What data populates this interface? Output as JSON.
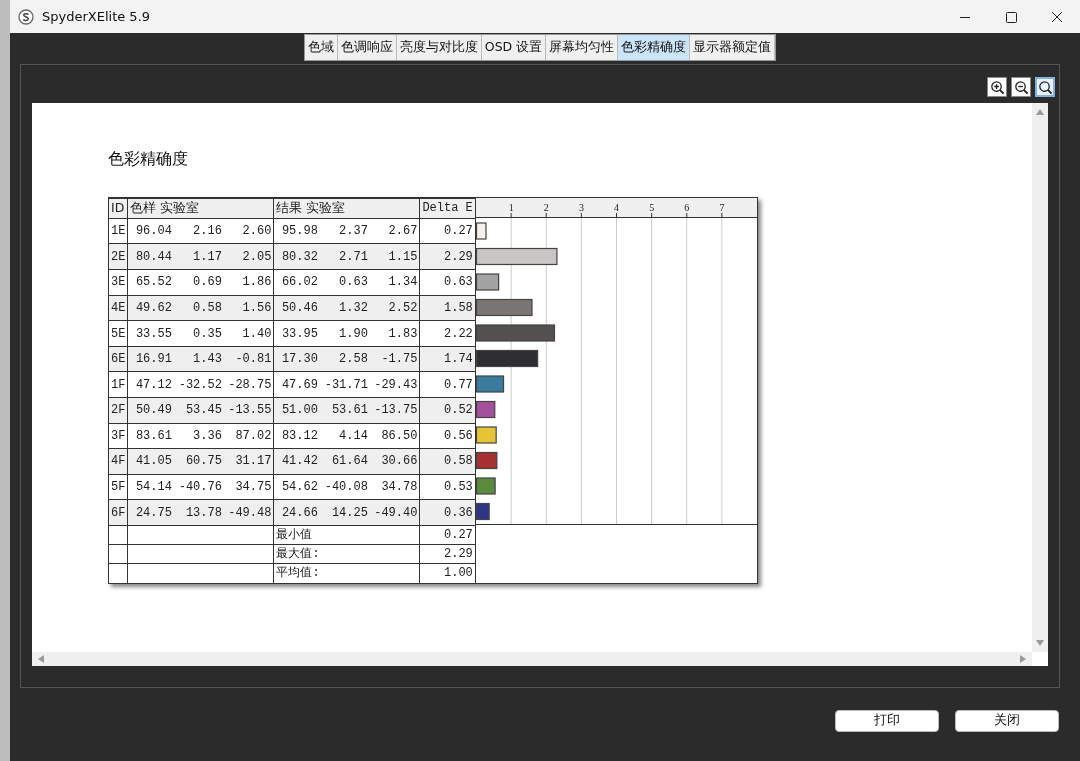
{
  "window": {
    "title": "SpyderXElite 5.9"
  },
  "tabs": [
    {
      "label": "色域",
      "selected": false
    },
    {
      "label": "色调响应",
      "selected": false
    },
    {
      "label": "亮度与对比度",
      "selected": false
    },
    {
      "label": "OSD 设置",
      "selected": false
    },
    {
      "label": "屏幕均匀性",
      "selected": false
    },
    {
      "label": "色彩精确度",
      "selected": true
    },
    {
      "label": "显示器额定值",
      "selected": false
    }
  ],
  "zoom_tools": [
    {
      "kind": "zoom-in",
      "selected": false
    },
    {
      "kind": "zoom-out",
      "selected": false
    },
    {
      "kind": "zoom-fit",
      "selected": true
    }
  ],
  "report": {
    "title": "色彩精确度",
    "table": {
      "columns": [
        "ID",
        "色样 实验室",
        "结果 实验室",
        "Delta E"
      ],
      "rows": [
        {
          "id": "1E",
          "sample": [
            "96.04",
            "2.16",
            "2.60"
          ],
          "result": [
            "95.98",
            "2.37",
            "2.67"
          ],
          "delta_e": "0.27",
          "color": "#f5f0ec"
        },
        {
          "id": "2E",
          "sample": [
            "80.44",
            "1.17",
            "2.05"
          ],
          "result": [
            "80.32",
            "2.71",
            "1.15"
          ],
          "delta_e": "2.29",
          "color": "#c8c5c4"
        },
        {
          "id": "3E",
          "sample": [
            "65.52",
            "0.69",
            "1.86"
          ],
          "result": [
            "66.02",
            "0.63",
            "1.34"
          ],
          "delta_e": "0.63",
          "color": "#a3a3a3"
        },
        {
          "id": "4E",
          "sample": [
            "49.62",
            "0.58",
            "1.56"
          ],
          "result": [
            "50.46",
            "1.32",
            "2.52"
          ],
          "delta_e": "1.58",
          "color": "#7a7674"
        },
        {
          "id": "5E",
          "sample": [
            "33.55",
            "0.35",
            "1.40"
          ],
          "result": [
            "33.95",
            "1.90",
            "1.83"
          ],
          "delta_e": "2.22",
          "color": "#545050"
        },
        {
          "id": "6E",
          "sample": [
            "16.91",
            "1.43",
            "-0.81"
          ],
          "result": [
            "17.30",
            "2.58",
            "-1.75"
          ],
          "delta_e": "1.74",
          "color": "#2f2e30"
        },
        {
          "id": "1F",
          "sample": [
            "47.12",
            "-32.52",
            "-28.75"
          ],
          "result": [
            "47.69",
            "-31.71",
            "-29.43"
          ],
          "delta_e": "0.77",
          "color": "#3a7a9c"
        },
        {
          "id": "2F",
          "sample": [
            "50.49",
            "53.45",
            "-13.55"
          ],
          "result": [
            "51.00",
            "53.61",
            "-13.75"
          ],
          "delta_e": "0.52",
          "color": "#a4509a"
        },
        {
          "id": "3F",
          "sample": [
            "83.61",
            "3.36",
            "87.02"
          ],
          "result": [
            "83.12",
            "4.14",
            "86.50"
          ],
          "delta_e": "0.56",
          "color": "#e6c534"
        },
        {
          "id": "4F",
          "sample": [
            "41.05",
            "60.75",
            "31.17"
          ],
          "result": [
            "41.42",
            "61.64",
            "30.66"
          ],
          "delta_e": "0.58",
          "color": "#a83030"
        },
        {
          "id": "5F",
          "sample": [
            "54.14",
            "-40.76",
            "34.75"
          ],
          "result": [
            "54.62",
            "-40.08",
            "34.78"
          ],
          "delta_e": "0.53",
          "color": "#5a8a3c"
        },
        {
          "id": "6F",
          "sample": [
            "24.75",
            "13.78",
            "-49.48"
          ],
          "result": [
            "24.66",
            "14.25",
            "-49.40"
          ],
          "delta_e": "0.36",
          "color": "#2e3585"
        }
      ],
      "summary": [
        {
          "label": "最小值",
          "value": "0.27"
        },
        {
          "label": "最大值:",
          "value": "2.29"
        },
        {
          "label": "平均值:",
          "value": "1.00"
        }
      ]
    },
    "chart_data": {
      "type": "bar",
      "orientation": "horizontal",
      "grid": true,
      "series": [
        {
          "values": [
            0.27,
            2.29,
            0.63,
            1.58,
            2.22,
            1.74,
            0.77,
            0.52,
            0.56,
            0.58,
            0.53,
            0.36
          ]
        }
      ],
      "xlim": [
        0,
        8
      ],
      "xticks": [
        1,
        2,
        3,
        4,
        5,
        6,
        7
      ]
    }
  },
  "buttons": [
    "打印",
    "关闭"
  ]
}
